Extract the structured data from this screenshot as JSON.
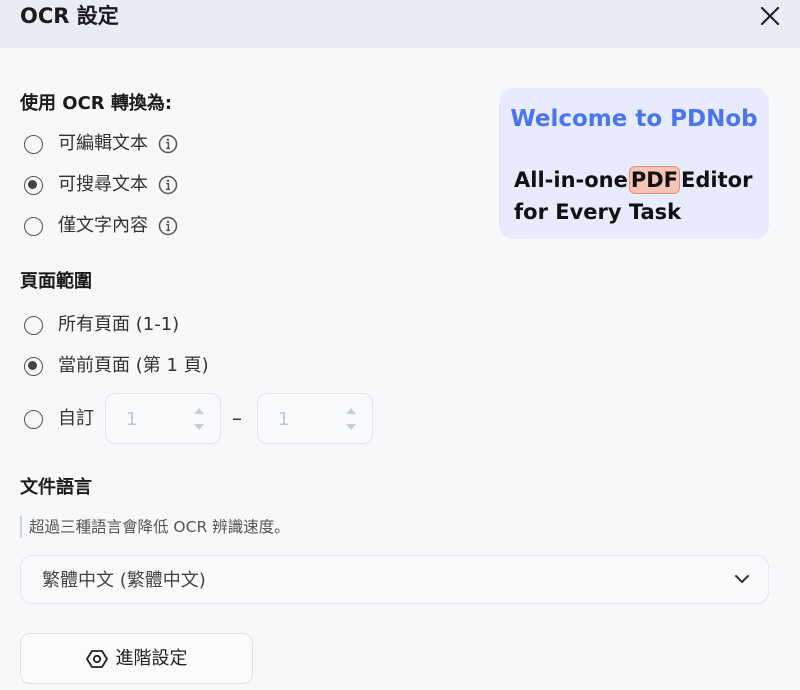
{
  "dialog": {
    "title": "OCR 設定"
  },
  "convert_section": {
    "heading": "使用 OCR 轉換為:",
    "options": [
      {
        "label": "可編輯文本",
        "checked": false
      },
      {
        "label": "可搜尋文本",
        "checked": true
      },
      {
        "label": "僅文字內容",
        "checked": false
      }
    ]
  },
  "page_range": {
    "heading": "頁面範圍",
    "options": [
      {
        "label": "所有頁面 (1-1)",
        "checked": false
      },
      {
        "label": "當前頁面 (第 1 頁)",
        "checked": true
      },
      {
        "label": "自訂",
        "checked": false
      }
    ],
    "custom_from": "1",
    "separator": "–",
    "custom_to": "1"
  },
  "language": {
    "heading": "文件語言",
    "hint": "超過三種語言會降低 OCR 辨識速度。",
    "selected": "繁體中文 (繁體中文)"
  },
  "advanced_button": {
    "label": "進階設定"
  },
  "promo_banner": {
    "title": "Welcome to PDNob",
    "line1_before": "All-in-one",
    "line1_highlight": "PDF",
    "line1_after": "Editor",
    "line2": "for Every Task"
  },
  "icons": {
    "close": "close-icon",
    "info": "info-icon",
    "spin_up": "chevron-up-icon",
    "spin_down": "chevron-down-icon",
    "dropdown": "chevron-down-icon",
    "settings": "hexagon-gear-icon"
  },
  "colors": {
    "header_bg": "#e9ecf4",
    "banner_bg": "#e8ebfd",
    "banner_title": "#4a74f0",
    "pdf_highlight": "#f6c5b6"
  }
}
